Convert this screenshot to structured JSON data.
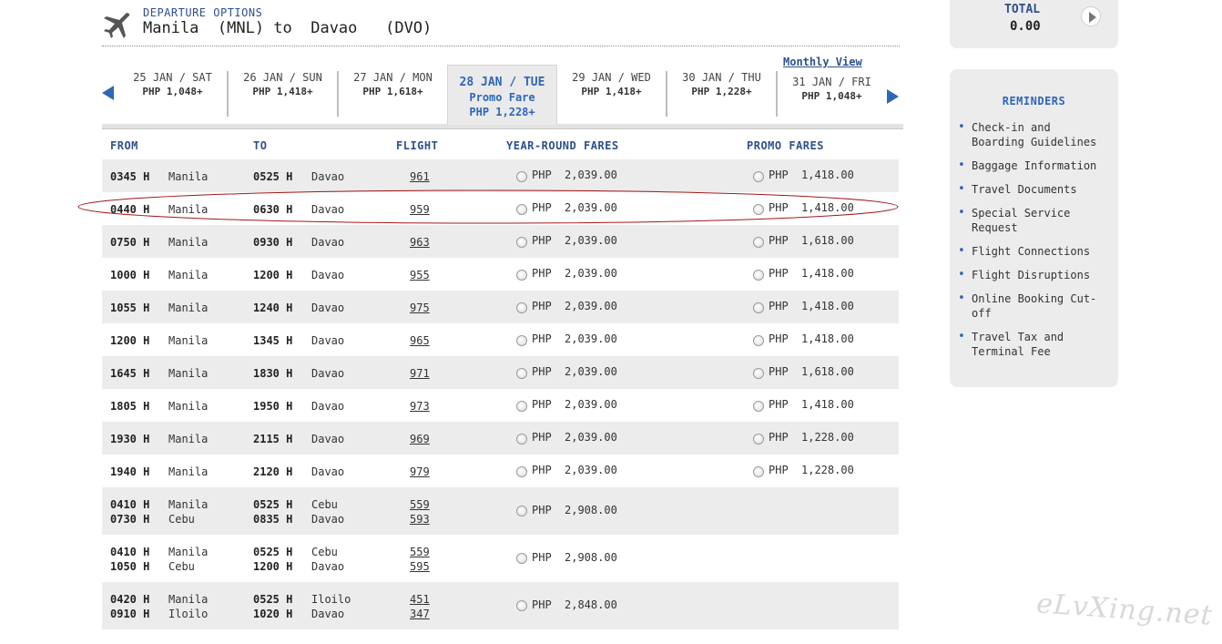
{
  "header": {
    "label": "DEPARTURE OPTIONS",
    "route": "Manila  (MNL) to  Davao   (DVO)"
  },
  "monthly_view": "Monthly View",
  "dates": [
    {
      "day": "25 JAN / SAT",
      "price": "PHP 1,048+"
    },
    {
      "day": "26 JAN / SUN",
      "price": "PHP 1,418+"
    },
    {
      "day": "27 JAN / MON",
      "price": "PHP 1,618+"
    },
    {
      "day": "28 JAN / TUE",
      "promo": "Promo Fare",
      "price": "PHP  1,228+",
      "selected": true
    },
    {
      "day": "29 JAN / WED",
      "price": "PHP 1,418+"
    },
    {
      "day": "30 JAN / THU",
      "price": "PHP 1,228+"
    },
    {
      "day": "31 JAN / FRI",
      "price": "PHP 1,048+"
    }
  ],
  "columns": {
    "from": "FROM",
    "to": "TO",
    "flight": "FLIGHT",
    "year_round": "YEAR-ROUND FARES",
    "promo": "PROMO FARES"
  },
  "flights": [
    {
      "dep": "0345 H",
      "from": "Manila",
      "arr": "0525 H",
      "to": "Davao",
      "flight": "961",
      "yr_cur": "PHP",
      "yr": "2,039.00",
      "pr_cur": "PHP",
      "pr": "1,418.00"
    },
    {
      "dep": "0440 H",
      "from": "Manila",
      "arr": "0630 H",
      "to": "Davao",
      "flight": "959",
      "yr_cur": "PHP",
      "yr": "2,039.00",
      "pr_cur": "PHP",
      "pr": "1,418.00"
    },
    {
      "dep": "0750 H",
      "from": "Manila",
      "arr": "0930 H",
      "to": "Davao",
      "flight": "963",
      "yr_cur": "PHP",
      "yr": "2,039.00",
      "pr_cur": "PHP",
      "pr": "1,618.00"
    },
    {
      "dep": "1000 H",
      "from": "Manila",
      "arr": "1200 H",
      "to": "Davao",
      "flight": "955",
      "yr_cur": "PHP",
      "yr": "2,039.00",
      "pr_cur": "PHP",
      "pr": "1,418.00"
    },
    {
      "dep": "1055 H",
      "from": "Manila",
      "arr": "1240 H",
      "to": "Davao",
      "flight": "975",
      "yr_cur": "PHP",
      "yr": "2,039.00",
      "pr_cur": "PHP",
      "pr": "1,418.00"
    },
    {
      "dep": "1200 H",
      "from": "Manila",
      "arr": "1345 H",
      "to": "Davao",
      "flight": "965",
      "yr_cur": "PHP",
      "yr": "2,039.00",
      "pr_cur": "PHP",
      "pr": "1,418.00"
    },
    {
      "dep": "1645 H",
      "from": "Manila",
      "arr": "1830 H",
      "to": "Davao",
      "flight": "971",
      "yr_cur": "PHP",
      "yr": "2,039.00",
      "pr_cur": "PHP",
      "pr": "1,618.00"
    },
    {
      "dep": "1805 H",
      "from": "Manila",
      "arr": "1950 H",
      "to": "Davao",
      "flight": "973",
      "yr_cur": "PHP",
      "yr": "2,039.00",
      "pr_cur": "PHP",
      "pr": "1,418.00"
    },
    {
      "dep": "1930 H",
      "from": "Manila",
      "arr": "2115 H",
      "to": "Davao",
      "flight": "969",
      "yr_cur": "PHP",
      "yr": "2,039.00",
      "pr_cur": "PHP",
      "pr": "1,228.00"
    },
    {
      "dep": "1940 H",
      "from": "Manila",
      "arr": "2120 H",
      "to": "Davao",
      "flight": "979",
      "yr_cur": "PHP",
      "yr": "2,039.00",
      "pr_cur": "PHP",
      "pr": "1,228.00"
    }
  ],
  "connections": [
    {
      "dep1": "0410 H",
      "from1": "Manila",
      "arr1": "0525 H",
      "to1": "Cebu",
      "fl1": "559",
      "dep2": "0730 H",
      "from2": "Cebu",
      "arr2": "0835 H",
      "to2": "Davao",
      "fl2": "593",
      "yr_cur": "PHP",
      "yr": "2,908.00"
    },
    {
      "dep1": "0410 H",
      "from1": "Manila",
      "arr1": "0525 H",
      "to1": "Cebu",
      "fl1": "559",
      "dep2": "1050 H",
      "from2": "Cebu",
      "arr2": "1200 H",
      "to2": "Davao",
      "fl2": "595",
      "yr_cur": "PHP",
      "yr": "2,908.00"
    },
    {
      "dep1": "0420 H",
      "from1": "Manila",
      "arr1": "0525 H",
      "to1": "Iloilo",
      "fl1": "451",
      "dep2": "0910 H",
      "from2": "Iloilo",
      "arr2": "1020 H",
      "to2": "Davao",
      "fl2": "347",
      "yr_cur": "PHP",
      "yr": "2,848.00"
    }
  ],
  "total": {
    "label": "TOTAL",
    "value": "0.00"
  },
  "reminders": {
    "title": "REMINDERS",
    "items": [
      "Check-in and Boarding Guidelines",
      "Baggage Information",
      "Travel Documents",
      "Special Service Request",
      "Flight Connections",
      "Flight Disruptions",
      "Online Booking Cut-off",
      "Travel Tax and Terminal Fee"
    ]
  },
  "watermark": "eLvXing.net",
  "colors": {
    "accent_blue": "#2e66b8",
    "row_shade": "#ececec",
    "highlight_ellipse": "#a01818"
  },
  "icons": [
    "plane-icon",
    "arrow-left-icon",
    "arrow-right-icon",
    "play-icon"
  ]
}
